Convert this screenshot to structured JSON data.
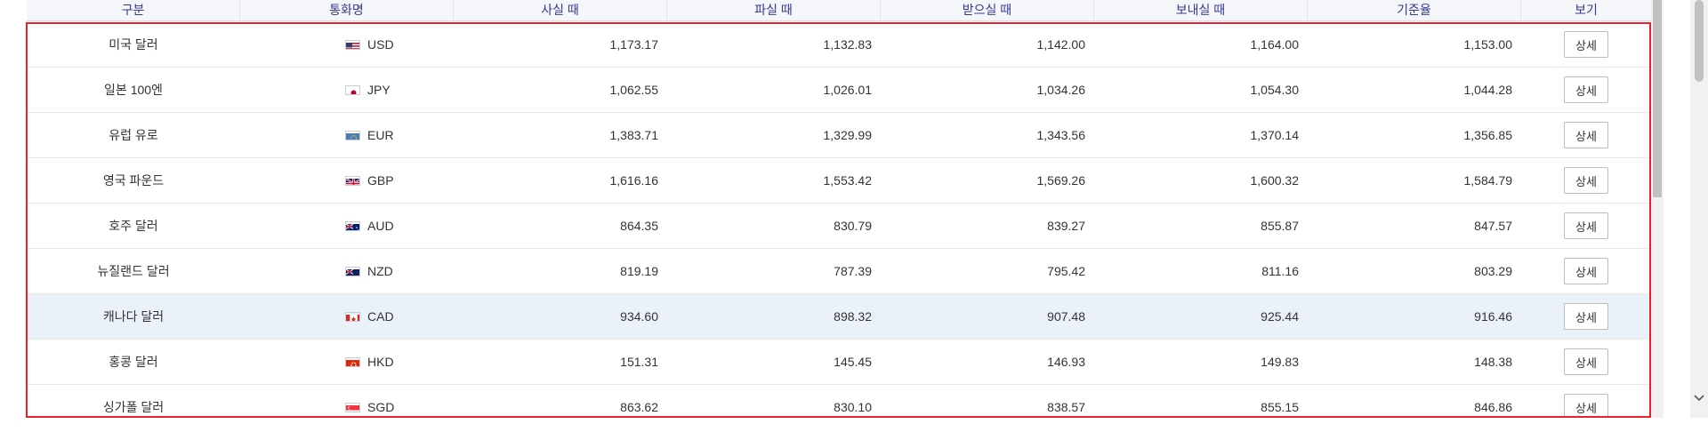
{
  "table": {
    "headers": [
      "구분",
      "통화명",
      "사실 때",
      "파실 때",
      "받으실 때",
      "보내실 때",
      "기준율",
      "보기"
    ],
    "detail_label": "상세",
    "rows": [
      {
        "name": "미국 달러",
        "code": "USD",
        "flag": "us-flag-icon",
        "buy": "1,173.17",
        "sell": "1,132.83",
        "receive": "1,142.00",
        "send": "1,164.00",
        "base": "1,153.00"
      },
      {
        "name": "일본 100엔",
        "code": "JPY",
        "flag": "jp-flag-icon",
        "buy": "1,062.55",
        "sell": "1,026.01",
        "receive": "1,034.26",
        "send": "1,054.30",
        "base": "1,044.28"
      },
      {
        "name": "유럽 유로",
        "code": "EUR",
        "flag": "eu-flag-icon",
        "buy": "1,383.71",
        "sell": "1,329.99",
        "receive": "1,343.56",
        "send": "1,370.14",
        "base": "1,356.85"
      },
      {
        "name": "영국 파운드",
        "code": "GBP",
        "flag": "gb-flag-icon",
        "buy": "1,616.16",
        "sell": "1,553.42",
        "receive": "1,569.26",
        "send": "1,600.32",
        "base": "1,584.79"
      },
      {
        "name": "호주 달러",
        "code": "AUD",
        "flag": "au-flag-icon",
        "buy": "864.35",
        "sell": "830.79",
        "receive": "839.27",
        "send": "855.87",
        "base": "847.57"
      },
      {
        "name": "뉴질랜드 달러",
        "code": "NZD",
        "flag": "nz-flag-icon",
        "buy": "819.19",
        "sell": "787.39",
        "receive": "795.42",
        "send": "811.16",
        "base": "803.29"
      },
      {
        "name": "캐나다 달러",
        "code": "CAD",
        "flag": "ca-flag-icon",
        "buy": "934.60",
        "sell": "898.32",
        "receive": "907.48",
        "send": "925.44",
        "base": "916.46"
      },
      {
        "name": "홍콩 달러",
        "code": "HKD",
        "flag": "hk-flag-icon",
        "buy": "151.31",
        "sell": "145.45",
        "receive": "146.93",
        "send": "149.83",
        "base": "148.38"
      },
      {
        "name": "싱가폴 달러",
        "code": "SGD",
        "flag": "sg-flag-icon",
        "buy": "863.62",
        "sell": "830.10",
        "receive": "838.57",
        "send": "855.15",
        "base": "846.86"
      }
    ],
    "highlighted_row_code": "CAD"
  },
  "colors": {
    "selection_border": "#e8212c",
    "header_text": "#333b8f",
    "row_highlight": "#eaf1f9"
  }
}
